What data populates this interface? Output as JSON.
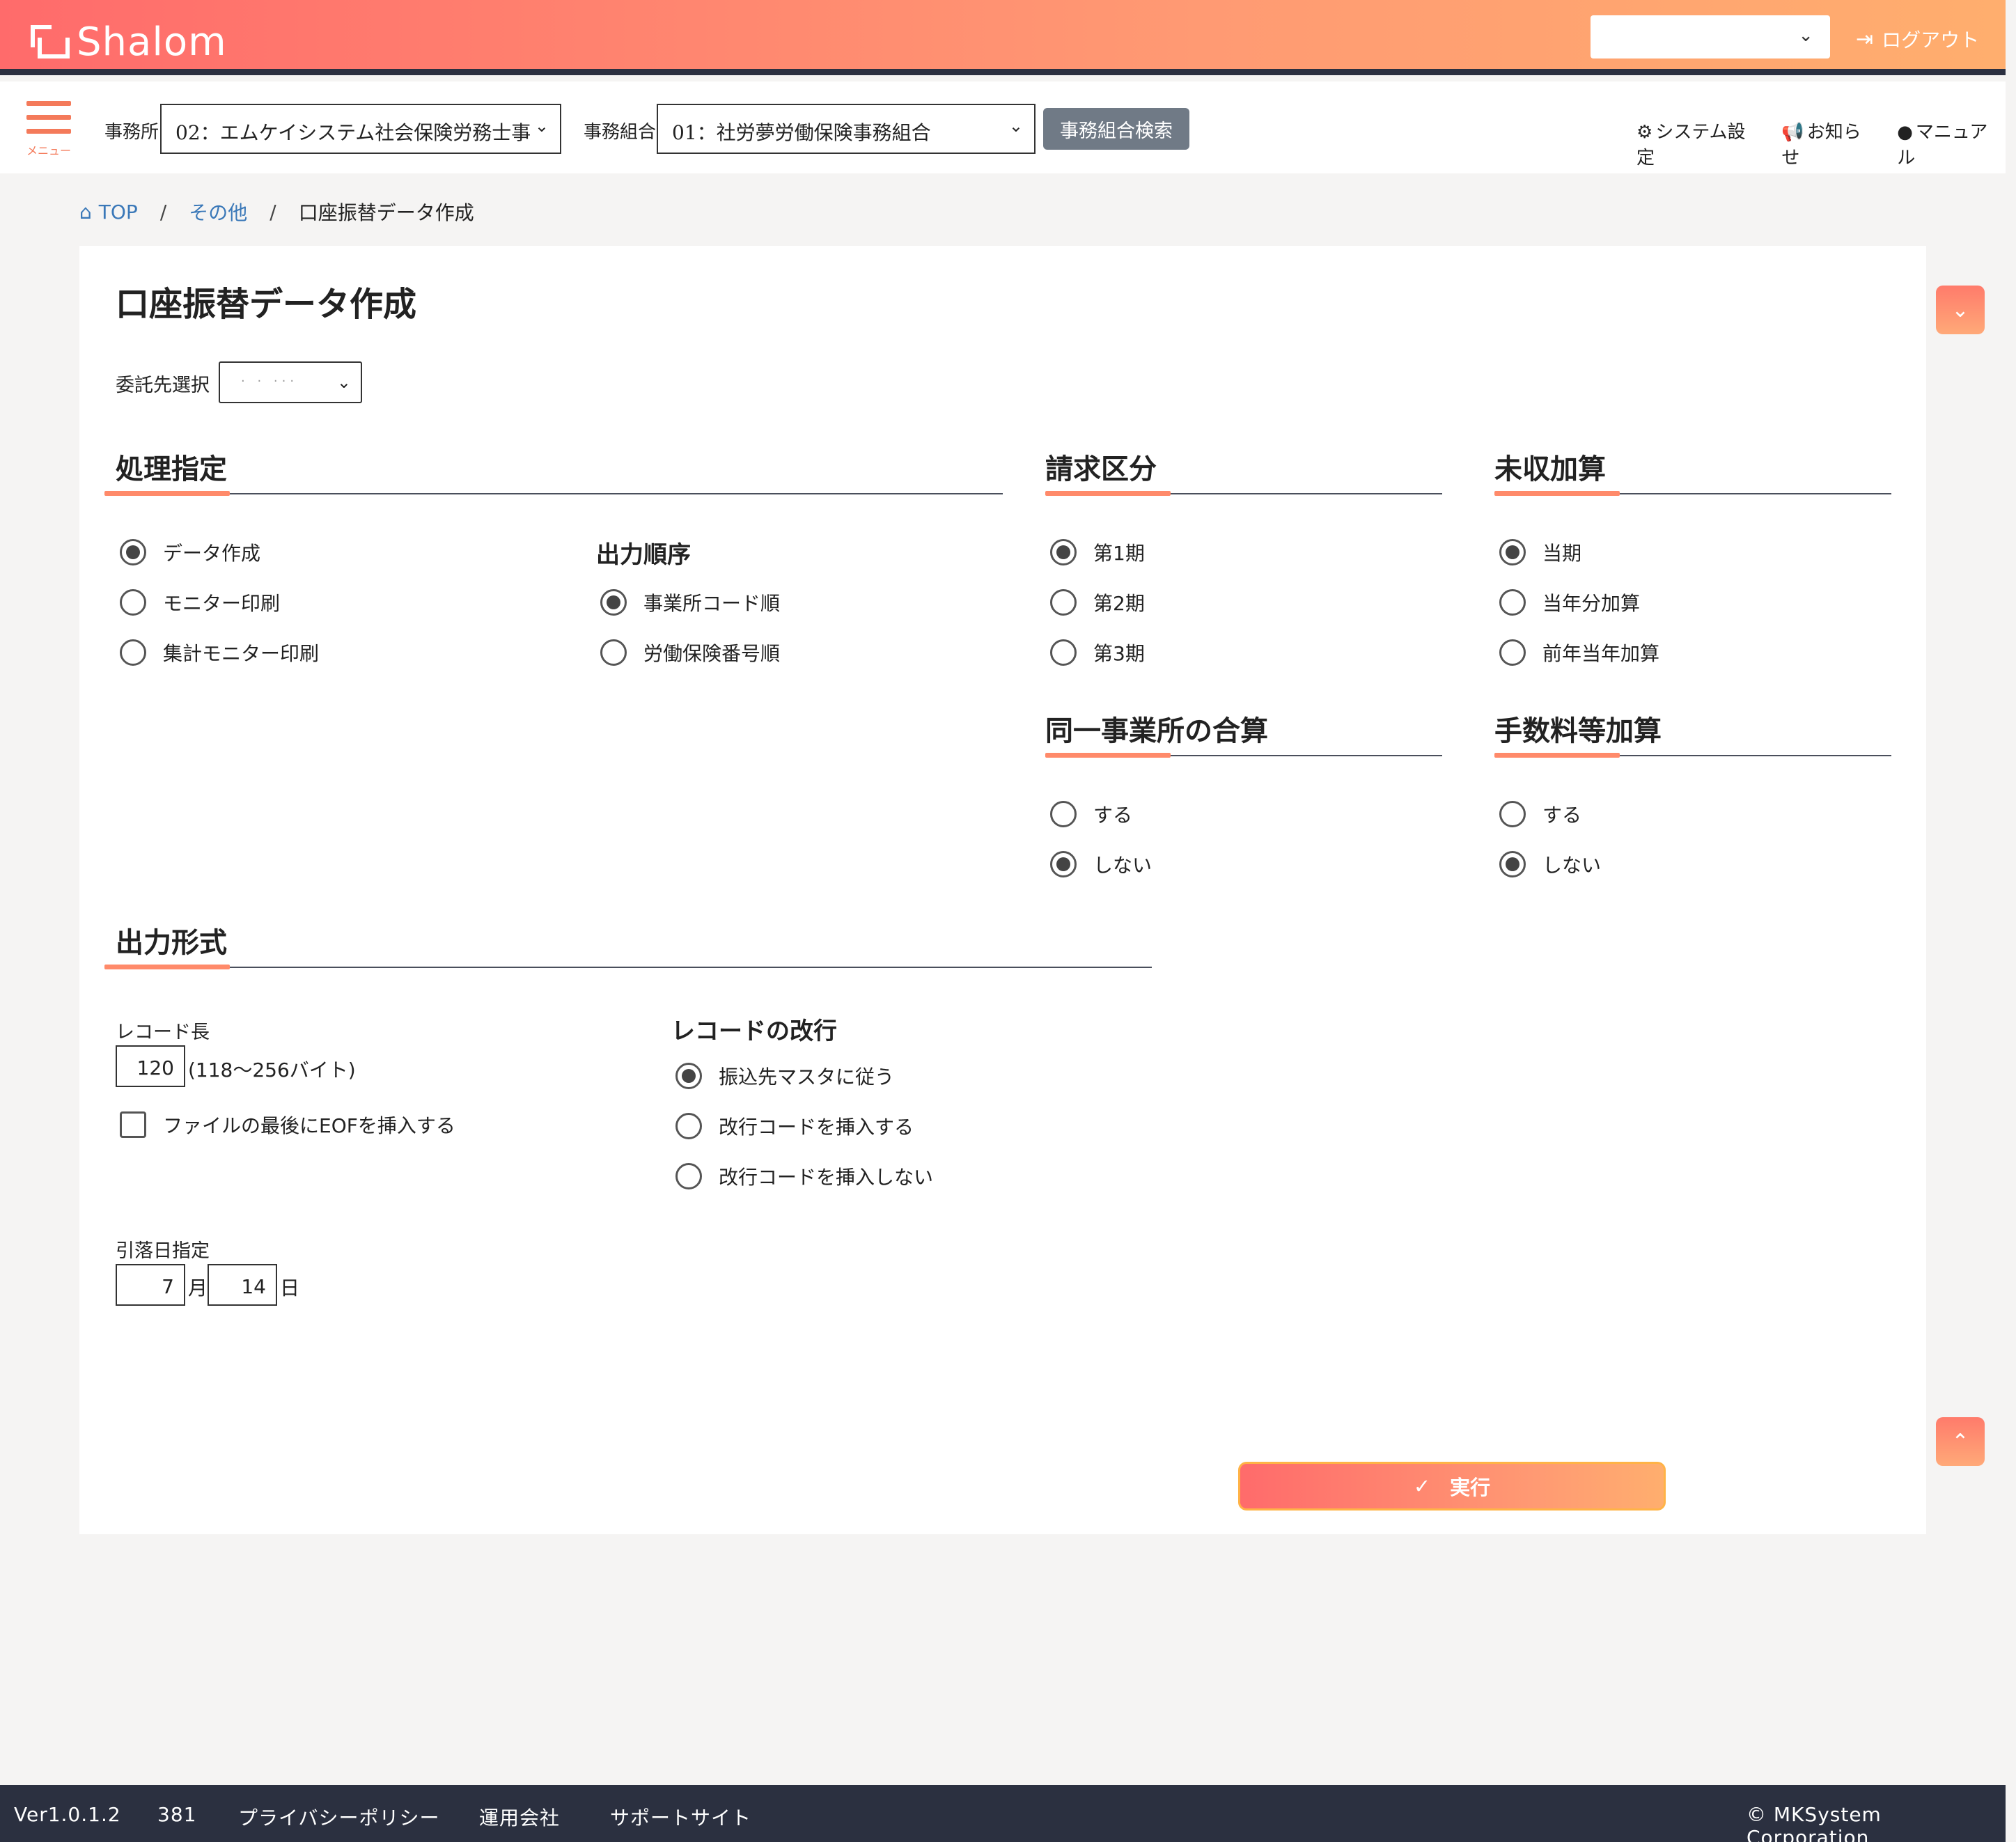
{
  "app": {
    "name": "Shalom",
    "logout": "ログアウト",
    "menu_label": "メニュー"
  },
  "header": {
    "jimusho_label": "事務所",
    "jimusho_value": "02：エムケイシステム社会保険労務士事",
    "kumiai_label": "事務組合",
    "kumiai_value": "01：社労夢労働保険事務組合",
    "search_button": "事務組合検索",
    "links": {
      "settings": "システム設定",
      "notice": "お知らせ",
      "manual": "マニュアル"
    }
  },
  "breadcrumb": {
    "top": "TOP",
    "middle": "その他",
    "current": "口座振替データ作成"
  },
  "page": {
    "title": "口座振替データ作成",
    "itaku_label": "委託先選択",
    "itaku_value": "· · ···"
  },
  "shori": {
    "heading": "処理指定",
    "options": [
      "データ作成",
      "モニター印刷",
      "集計モニター印刷"
    ],
    "selected": 0
  },
  "shutsuryoku_junjo": {
    "heading": "出力順序",
    "options": [
      "事業所コード順",
      "労働保険番号順"
    ],
    "selected": 0
  },
  "seikyu": {
    "heading": "請求区分",
    "options": [
      "第1期",
      "第2期",
      "第3期"
    ],
    "selected": 0
  },
  "mishu": {
    "heading": "未収加算",
    "options": [
      "当期",
      "当年分加算",
      "前年当年加算"
    ],
    "selected": 0
  },
  "gassan": {
    "heading": "同一事業所の合算",
    "options": [
      "する",
      "しない"
    ],
    "selected": 1
  },
  "tesuryo": {
    "heading": "手数料等加算",
    "options": [
      "する",
      "しない"
    ],
    "selected": 1
  },
  "keishiki": {
    "heading": "出力形式",
    "record_length_label": "レコード長",
    "record_length_value": "120",
    "record_length_hint": "(118〜256バイト)",
    "eof_label": "ファイルの最後にEOFを挿入する",
    "kaigyo_heading": "レコードの改行",
    "kaigyo_options": [
      "振込先マスタに従う",
      "改行コードを挿入する",
      "改行コードを挿入しない"
    ],
    "kaigyo_selected": 0,
    "hikiotoshi_label": "引落日指定",
    "month_value": "7",
    "month_unit": "月",
    "day_value": "14",
    "day_unit": "日"
  },
  "actions": {
    "execute": "実行"
  },
  "footer": {
    "version": "Ver1.0.1.2",
    "build": "381",
    "privacy": "プライバシーポリシー",
    "company": "運用会社",
    "support": "サポートサイト",
    "copyright": "© MKSystem Corporation"
  },
  "colors": {
    "accent": "#ff8a6a",
    "link": "#3a78b8",
    "dark": "#2b3040"
  }
}
